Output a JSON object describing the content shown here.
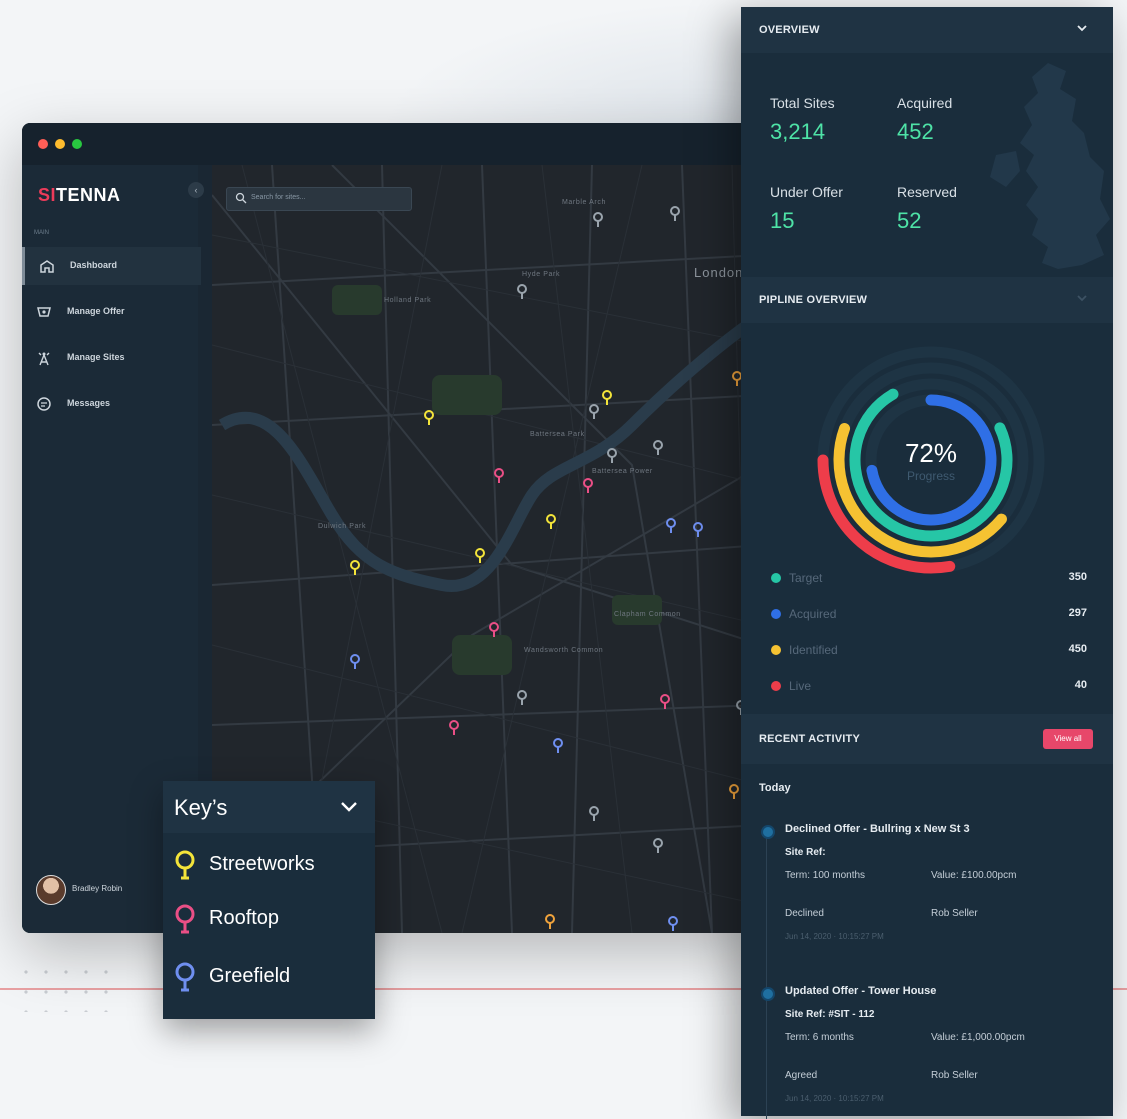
{
  "app": {
    "logo": {
      "prefix": "SI",
      "suffix": "TENNA"
    },
    "sidebar": {
      "section_label": "MAIN",
      "items": [
        {
          "label": "Dashboard",
          "icon": "dashboard-icon",
          "active": true
        },
        {
          "label": "Manage Offer",
          "icon": "offer-icon",
          "active": false
        },
        {
          "label": "Manage Sites",
          "icon": "tower-icon",
          "active": false
        },
        {
          "label": "Messages",
          "icon": "message-icon",
          "active": false
        }
      ],
      "user": {
        "name": "Bradley Robin"
      }
    },
    "map": {
      "search_placeholder": "Search for sites...",
      "labels": [
        "Marble Arch",
        "Hyde Park",
        "Holland Park",
        "Battersea Park",
        "Clapham Common",
        "Battersea Power",
        "Wandsworth Common",
        "Dulwich Park",
        "London"
      ]
    }
  },
  "overview": {
    "title": "OVERVIEW",
    "stats": [
      {
        "label": "Total Sites",
        "value": "3,214"
      },
      {
        "label": "Acquired",
        "value": "452"
      },
      {
        "label": "Under Offer",
        "value": "15"
      },
      {
        "label": "Reserved",
        "value": "52"
      }
    ]
  },
  "pipeline": {
    "title": "PIPLINE OVERVIEW",
    "progress_value": "72%",
    "progress_label": "Progress",
    "legend": [
      {
        "name": "Target",
        "value": "350",
        "color": "#26c6a6"
      },
      {
        "name": "Acquired",
        "value": "297",
        "color": "#2f6fe6"
      },
      {
        "name": "Identified",
        "value": "450",
        "color": "#f5c232"
      },
      {
        "name": "Live",
        "value": "40",
        "color": "#ee3d4a"
      }
    ]
  },
  "activity": {
    "title": "RECENT ACTIVITY",
    "view_all": "View all",
    "day": "Today",
    "items": [
      {
        "title": "Declined Offer - Bullring x New St 3",
        "site_ref": "Site Ref:",
        "term": "Term: 100 months",
        "value": "Value: £100.00pcm",
        "status": "Declined",
        "by": "Rob Seller",
        "time": "Jun 14, 2020 · 10:15:27 PM"
      },
      {
        "title": "Updated Offer - Tower House",
        "site_ref": "Site Ref: #SIT - 112",
        "term": "Term: 6 months",
        "value": "Value: £1,000.00pcm",
        "status": "Agreed",
        "by": "Rob Seller",
        "time": "Jun 14, 2020 · 10:15:27 PM"
      }
    ]
  },
  "keys": {
    "title": "Key’s",
    "items": [
      {
        "label": "Streetworks",
        "color": "#f3e43a"
      },
      {
        "label": "Rooftop",
        "color": "#ea4f86"
      },
      {
        "label": "Greefield",
        "color": "#6f8ff0"
      }
    ]
  },
  "colors": {
    "accent_green": "#4ee3a7",
    "accent_pink": "#e7476a",
    "panel": "#1a2d3c"
  }
}
